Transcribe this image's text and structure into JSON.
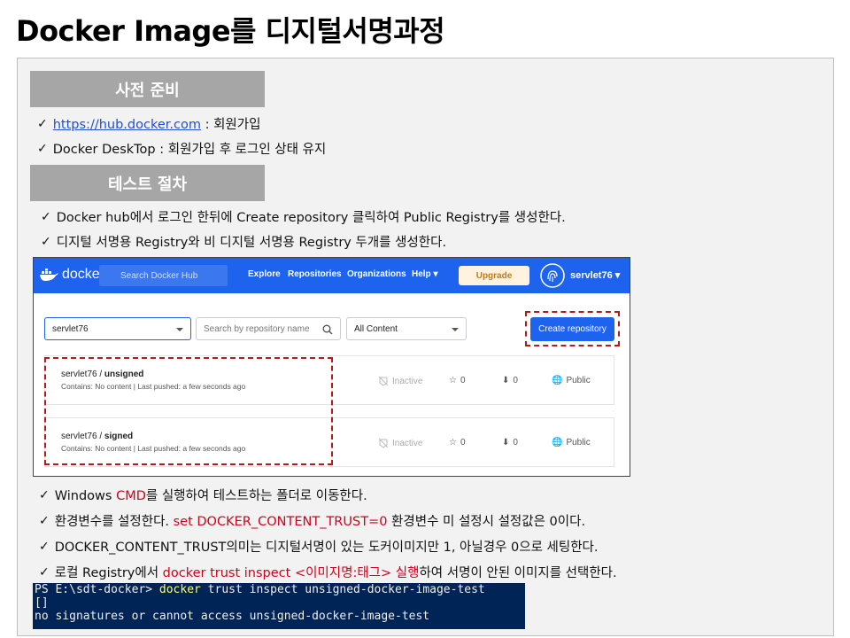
{
  "title": "Docker Image를 디지털서명과정",
  "sections": {
    "prep": {
      "header": "사전 준비",
      "items": [
        {
          "link": "https://hub.docker.com",
          "text": " : 회원가입"
        },
        {
          "text": "Docker DeskTop : 회원가입 후 로그인 상태 유지"
        }
      ]
    },
    "test": {
      "header": "테스트 절차",
      "items": [
        "Docker hub에서 로그인 한뒤에 Create repository 클릭하여 Public Registry를 생성한다.",
        "디지털 서명용 Registry와 비 디지털 서명용 Registry 두개를 생성한다."
      ]
    }
  },
  "hub": {
    "logo": "docker hub",
    "search_placeholder": "Search Docker Hub",
    "menu": [
      "Explore",
      "Repositories",
      "Organizations",
      "Help"
    ],
    "upgrade": "Upgrade",
    "username": "servlet76",
    "namespace_select": "servlet76",
    "repo_search_placeholder": "Search by repository name",
    "content_filter": "All Content",
    "create_button": "Create repository",
    "repos": [
      {
        "owner": "servlet76 / ",
        "name": "unsigned",
        "meta_a": "Contains: No content",
        "meta_b": " | Last pushed: a few seconds ago",
        "status": "Inactive",
        "stars": "0",
        "pulls": "0",
        "visibility": "Public"
      },
      {
        "owner": "servlet76 / ",
        "name": "signed",
        "meta_a": "Contains: No content",
        "meta_b": " | Last pushed: a few seconds ago",
        "status": "Inactive",
        "stars": "0",
        "pulls": "0",
        "visibility": "Public"
      }
    ]
  },
  "steps": {
    "s1_a": "Windows ",
    "s1_red": "CMD",
    "s1_b": "를 실행하여 테스트하는 폴더로 이동한다.",
    "s2_a": "환경변수를 설정한다. ",
    "s2_red": "set DOCKER_CONTENT_TRUST=0",
    "s2_b": "    환경변수 미 설정시 설정값은 0이다.",
    "s3": "DOCKER_CONTENT_TRUST의미는  디지털서명이 있는 도커이미지만 1, 아닐경우 0으로 세팅한다.",
    "s4_a": "로컬 Registry에서 ",
    "s4_red": "docker trust inspect <이미지명:태그> 실행",
    "s4_b": "하여 서명이 안된 이미지를 선택한다."
  },
  "terminal": {
    "prompt": "PS E:\\sdt-docker> ",
    "cmd_keyword": "docker",
    "cmd_rest": " trust inspect unsigned-docker-image-test",
    "line2": "[]",
    "line3": "no signatures or cannot access unsigned-docker-image-test"
  },
  "colors": {
    "docker_blue": "#1d63ed",
    "section_gray": "#a6a6a6",
    "highlight_red": "#d0021b",
    "terminal_bg": "#012456"
  }
}
